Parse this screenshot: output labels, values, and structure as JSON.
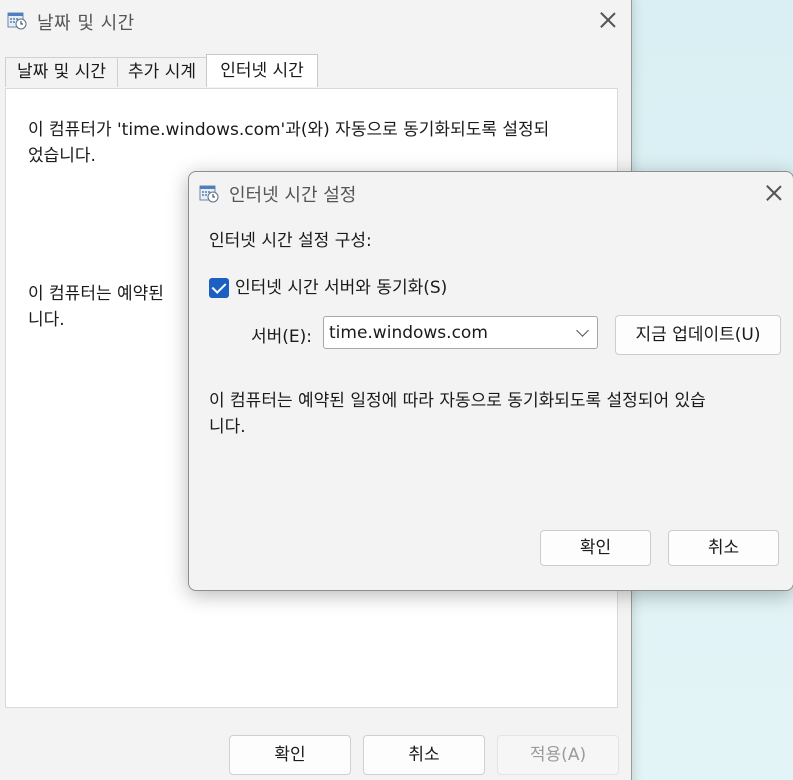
{
  "main": {
    "title": "날짜 및 시간",
    "tabs": [
      {
        "label": "날짜 및 시간"
      },
      {
        "label": "추가 시계"
      },
      {
        "label": "인터넷 시간"
      }
    ],
    "panel_line1": "이 컴퓨터가 'time.windows.com'과(와) 자동으로 동기화되도록 설정되",
    "panel_line2": "었습니다.",
    "panel_line3": "이 컴퓨터는 예약된",
    "panel_line4": "니다.",
    "buttons": {
      "ok": "확인",
      "cancel": "취소",
      "apply": "적용(A)"
    }
  },
  "dialog": {
    "title": "인터넷 시간 설정",
    "heading": "인터넷 시간 설정 구성:",
    "sync_checkbox_label": "인터넷 시간 서버와 동기화(S)",
    "sync_checked": true,
    "server_label": "서버(E):",
    "server_value": "time.windows.com",
    "update_button": "지금 업데이트(U)",
    "info_line1": "이 컴퓨터는 예약된 일정에 따라 자동으로 동기화되도록 설정되어 있습",
    "info_line2": "니다.",
    "buttons": {
      "ok": "확인",
      "cancel": "취소"
    }
  },
  "colors": {
    "accent": "#1b5fc1",
    "window_bg": "#f3f3f3",
    "desktop_bg": "#dcf0f4"
  },
  "icons": {
    "window_icon": "calendar-clock-icon",
    "close": "close-icon",
    "dropdown": "chevron-down-icon"
  }
}
